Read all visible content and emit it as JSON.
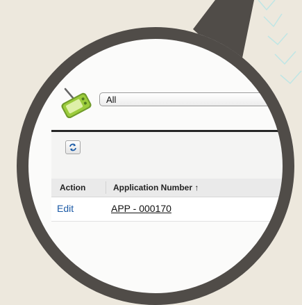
{
  "view": {
    "selected": "All"
  },
  "table": {
    "columns": [
      "Action",
      "Application Number ↑"
    ],
    "rows": [
      {
        "action": "Edit",
        "application_number": "APP - 000170"
      }
    ]
  },
  "colors": {
    "background": "#ede8dd",
    "frame": "#504c48",
    "link": "#1b5aa6",
    "decoration": "#bfe6e5"
  },
  "icons": [
    "pda-icon",
    "refresh-icon"
  ]
}
